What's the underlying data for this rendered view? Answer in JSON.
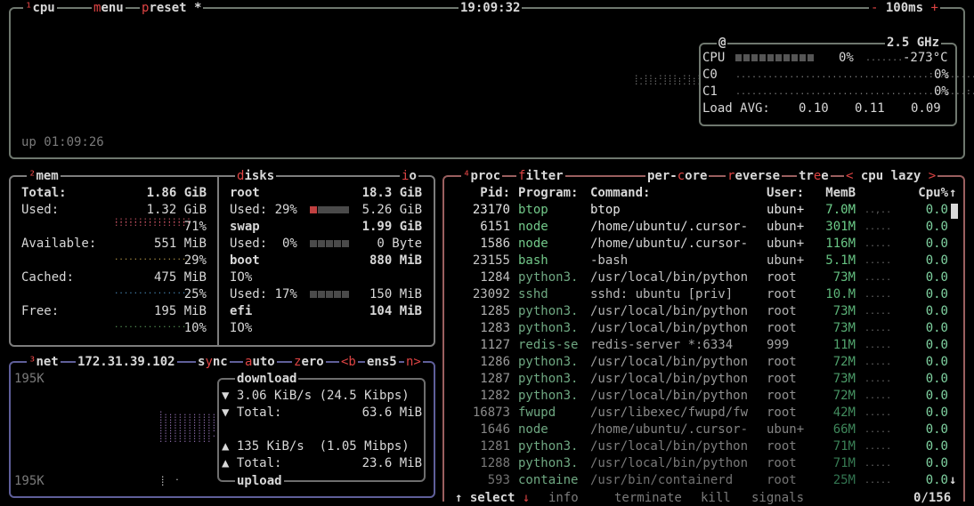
{
  "cpu": {
    "title": "cpu",
    "title_hk": "¹",
    "menu": "menu",
    "preset": "preset *",
    "clock": "19:09:32",
    "interval": "100ms",
    "uptime": "up 01:09:26",
    "freq_label": "@",
    "freq": "2.5 GHz",
    "cpu_label": "CPU",
    "cpu_pct": "0%",
    "cpu_temp": "-273°C",
    "cores": [
      {
        "label": "C0",
        "pct": "0%"
      },
      {
        "label": "C1",
        "pct": "0%"
      }
    ],
    "load_label": "Load AVG:",
    "load": [
      "0.10",
      "0.11",
      "0.09"
    ]
  },
  "mem": {
    "title": "mem",
    "title_hk": "²",
    "total_label": "Total:",
    "total": "1.86 GiB",
    "used_label": "Used:",
    "used": "1.32 GiB",
    "used_pct": "71%",
    "avail_label": "Available:",
    "avail": "551 MiB",
    "avail_pct": "29%",
    "cached_label": "Cached:",
    "cached": "475 MiB",
    "cached_pct": "25%",
    "free_label": "Free:",
    "free": "195 MiB",
    "free_pct": "10%"
  },
  "disks": {
    "title": "disks",
    "io": "io",
    "root_label": "root",
    "root_size": "18.3 GiB",
    "root_used_label": "Used: 29%",
    "root_used": "5.26 GiB",
    "swap_label": "swap",
    "swap_size": "1.99 GiB",
    "swap_used_label": "Used:  0%",
    "swap_used": "0 Byte",
    "boot_label": "boot",
    "boot_size": "880 MiB",
    "boot_io": "IO%",
    "boot_used_label": "Used: 17%",
    "boot_used": "150 MiB",
    "efi_label": "efi",
    "efi_size": "104 MiB",
    "efi_io": "IO%"
  },
  "net": {
    "title": "net",
    "title_hk": "³",
    "ip": "172.31.39.102",
    "sync": "sync",
    "auto": "auto",
    "zero": "zero",
    "prev": "<b",
    "iface": "ens5",
    "next": "n>",
    "scale_top": "195K",
    "scale_bottom": "195K",
    "download_label": "download",
    "dl_rate": "3.06 KiB/s (24.5 Kibps)",
    "dl_total_label": "Total:",
    "dl_total": "63.6 MiB",
    "ul_rate": "135 KiB/s  (1.05 Mibps)",
    "ul_total_label": "Total:",
    "ul_total": "23.6 MiB",
    "upload_label": "upload"
  },
  "proc": {
    "title": "proc",
    "title_hk": "⁴",
    "filter": "filter",
    "percore": "per-core",
    "reverse": "reverse",
    "tree": "tree",
    "sort": "cpu lazy",
    "headers": {
      "pid": "Pid:",
      "program": "Program:",
      "command": "Command:",
      "user": "User:",
      "mem": "MemB",
      "cpu": "Cpu%"
    },
    "rows": [
      {
        "pid": "23170",
        "program": "btop",
        "command": "btop",
        "user": "ubun+",
        "mem": "7.0M",
        "cpu": "0.0"
      },
      {
        "pid": "6151",
        "program": "node",
        "command": "/home/ubuntu/.cursor-",
        "user": "ubun+",
        "mem": "301M",
        "cpu": "0.0"
      },
      {
        "pid": "1586",
        "program": "node",
        "command": "/home/ubuntu/.cursor-",
        "user": "ubun+",
        "mem": "116M",
        "cpu": "0.0"
      },
      {
        "pid": "23155",
        "program": "bash",
        "command": "-bash",
        "user": "ubun+",
        "mem": "5.1M",
        "cpu": "0.0"
      },
      {
        "pid": "1284",
        "program": "python3.",
        "command": "/usr/local/bin/python",
        "user": "root",
        "mem": "73M",
        "cpu": "0.0"
      },
      {
        "pid": "23092",
        "program": "sshd",
        "command": "sshd: ubuntu [priv]",
        "user": "root",
        "mem": "10.M",
        "cpu": "0.0"
      },
      {
        "pid": "1285",
        "program": "python3.",
        "command": "/usr/local/bin/python",
        "user": "root",
        "mem": "73M",
        "cpu": "0.0"
      },
      {
        "pid": "1283",
        "program": "python3.",
        "command": "/usr/local/bin/python",
        "user": "root",
        "mem": "73M",
        "cpu": "0.0"
      },
      {
        "pid": "1127",
        "program": "redis-se",
        "command": "redis-server *:6334",
        "user": "999",
        "mem": "11M",
        "cpu": "0.0"
      },
      {
        "pid": "1286",
        "program": "python3.",
        "command": "/usr/local/bin/python",
        "user": "root",
        "mem": "72M",
        "cpu": "0.0"
      },
      {
        "pid": "1287",
        "program": "python3.",
        "command": "/usr/local/bin/python",
        "user": "root",
        "mem": "73M",
        "cpu": "0.0"
      },
      {
        "pid": "1282",
        "program": "python3.",
        "command": "/usr/local/bin/python",
        "user": "root",
        "mem": "72M",
        "cpu": "0.0"
      },
      {
        "pid": "16873",
        "program": "fwupd",
        "command": "/usr/libexec/fwupd/fw",
        "user": "root",
        "mem": "42M",
        "cpu": "0.0"
      },
      {
        "pid": "1646",
        "program": "node",
        "command": "/home/ubuntu/.cursor-",
        "user": "ubun+",
        "mem": "66M",
        "cpu": "0.0"
      },
      {
        "pid": "1281",
        "program": "python3.",
        "command": "/usr/local/bin/python",
        "user": "root",
        "mem": "71M",
        "cpu": "0.0"
      },
      {
        "pid": "1288",
        "program": "python3.",
        "command": "/usr/local/bin/python",
        "user": "root",
        "mem": "71M",
        "cpu": "0.0"
      },
      {
        "pid": "593",
        "program": "containe",
        "command": "/usr/bin/containerd",
        "user": "root",
        "mem": "25M",
        "cpu": "0.0"
      }
    ],
    "select": "select",
    "info": "info",
    "terminate": "terminate",
    "kill": "kill",
    "signals": "signals",
    "count": "0/156"
  },
  "colors": {
    "cpu_border": "#6f786f",
    "net_border": "#5f5f9a",
    "proc_border": "#9a5f5f",
    "hotkey": "#e04444",
    "value": "#7fd1a0"
  }
}
